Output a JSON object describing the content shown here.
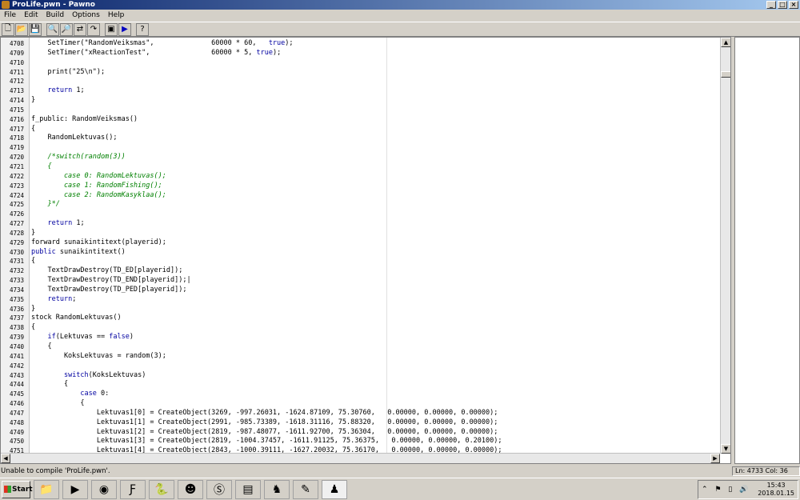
{
  "window": {
    "title": "ProLife.pwn - Pawno",
    "min": "_",
    "max": "□",
    "close": "×"
  },
  "menu": [
    "File",
    "Edit",
    "Build",
    "Options",
    "Help"
  ],
  "editor": {
    "lines": [
      {
        "n": "4708",
        "code": "    SetTimer(\"RandomVeiksmas\",              60000 * 60,   true);",
        "type": "code"
      },
      {
        "n": "4709",
        "code": "    SetTimer(\"xReactionTest\",               60000 * 5, true);",
        "type": "code"
      },
      {
        "n": "4710",
        "code": "",
        "type": "code"
      },
      {
        "n": "4711",
        "code": "    print(\"25\\n\");",
        "type": "code"
      },
      {
        "n": "4712",
        "code": "",
        "type": "code"
      },
      {
        "n": "4713",
        "code": "    return 1;",
        "type": "kw"
      },
      {
        "n": "4714",
        "code": "}",
        "type": "code"
      },
      {
        "n": "4715",
        "code": "",
        "type": "code"
      },
      {
        "n": "4716",
        "code": "f_public: RandomVeiksmas()",
        "type": "code"
      },
      {
        "n": "4717",
        "code": "{",
        "type": "code"
      },
      {
        "n": "4718",
        "code": "    RandomLektuvas();",
        "type": "code"
      },
      {
        "n": "4719",
        "code": "",
        "type": "code"
      },
      {
        "n": "4720",
        "code": "    /*switch(random(3))",
        "type": "cm"
      },
      {
        "n": "4721",
        "code": "    {",
        "type": "cm"
      },
      {
        "n": "4722",
        "code": "        case 0: RandomLektuvas();",
        "type": "cm"
      },
      {
        "n": "4723",
        "code": "        case 1: RandomFishing();",
        "type": "cm"
      },
      {
        "n": "4724",
        "code": "        case 2: RandomKasyklaa();",
        "type": "cm"
      },
      {
        "n": "4725",
        "code": "    }*/",
        "type": "cm"
      },
      {
        "n": "4726",
        "code": "",
        "type": "code"
      },
      {
        "n": "4727",
        "code": "    return 1;",
        "type": "kw"
      },
      {
        "n": "4728",
        "code": "}",
        "type": "code"
      },
      {
        "n": "4729",
        "code": "forward sunaikintitext(playerid);",
        "type": "code"
      },
      {
        "n": "4730",
        "code": "public sunaikintitext()",
        "type": "kw"
      },
      {
        "n": "4731",
        "code": "{",
        "type": "code"
      },
      {
        "n": "4732",
        "code": "    TextDrawDestroy(TD_ED[playerid]);",
        "type": "code"
      },
      {
        "n": "4733",
        "code": "    TextDrawDestroy(TD_END[playerid]);|",
        "type": "code"
      },
      {
        "n": "4734",
        "code": "    TextDrawDestroy(TD_PED[playerid]);",
        "type": "code"
      },
      {
        "n": "4735",
        "code": "    return;",
        "type": "kw"
      },
      {
        "n": "4736",
        "code": "}",
        "type": "code"
      },
      {
        "n": "4737",
        "code": "stock RandomLektuvas()",
        "type": "code"
      },
      {
        "n": "4738",
        "code": "{",
        "type": "code"
      },
      {
        "n": "4739",
        "code": "    if(Lektuvas == false)",
        "type": "kw"
      },
      {
        "n": "4740",
        "code": "    {",
        "type": "code"
      },
      {
        "n": "4741",
        "code": "        KoksLektuvas = random(3);",
        "type": "code"
      },
      {
        "n": "4742",
        "code": "",
        "type": "code"
      },
      {
        "n": "4743",
        "code": "        switch(KoksLektuvas)",
        "type": "kw"
      },
      {
        "n": "4744",
        "code": "        {",
        "type": "code"
      },
      {
        "n": "4745",
        "code": "            case 0:",
        "type": "kw"
      },
      {
        "n": "4746",
        "code": "            {",
        "type": "code"
      },
      {
        "n": "4747",
        "code": "                Lektuvas1[0] = CreateObject(3269, -997.26031, -1624.87109, 75.30760,   0.00000, 0.00000, 0.00000);",
        "type": "code"
      },
      {
        "n": "4748",
        "code": "                Lektuvas1[1] = CreateObject(2991, -985.73389, -1618.31116, 75.88320,   0.00000, 0.00000, 0.00000);",
        "type": "code"
      },
      {
        "n": "4749",
        "code": "                Lektuvas1[2] = CreateObject(2819, -987.48077, -1611.92700, 75.36304,   0.00000, 0.00000, 0.00000);",
        "type": "code"
      },
      {
        "n": "4750",
        "code": "                Lektuvas1[3] = CreateObject(2819, -1004.37457, -1611.91125, 75.36375,   0.00000, 0.00000, 0.20100);",
        "type": "code"
      },
      {
        "n": "4751",
        "code": "                Lektuvas1[4] = CreateObject(2843, -1000.39111, -1627.20032, 75.36170,   0.00000, 0.00000, 0.00000);",
        "type": "code"
      }
    ]
  },
  "status": {
    "message": "Unable to compile 'ProLife.pwn'.",
    "position": "Ln: 4733  Col: 36"
  },
  "taskbar": {
    "start": "Start",
    "time": "15:43",
    "date": "2018.01.15"
  }
}
